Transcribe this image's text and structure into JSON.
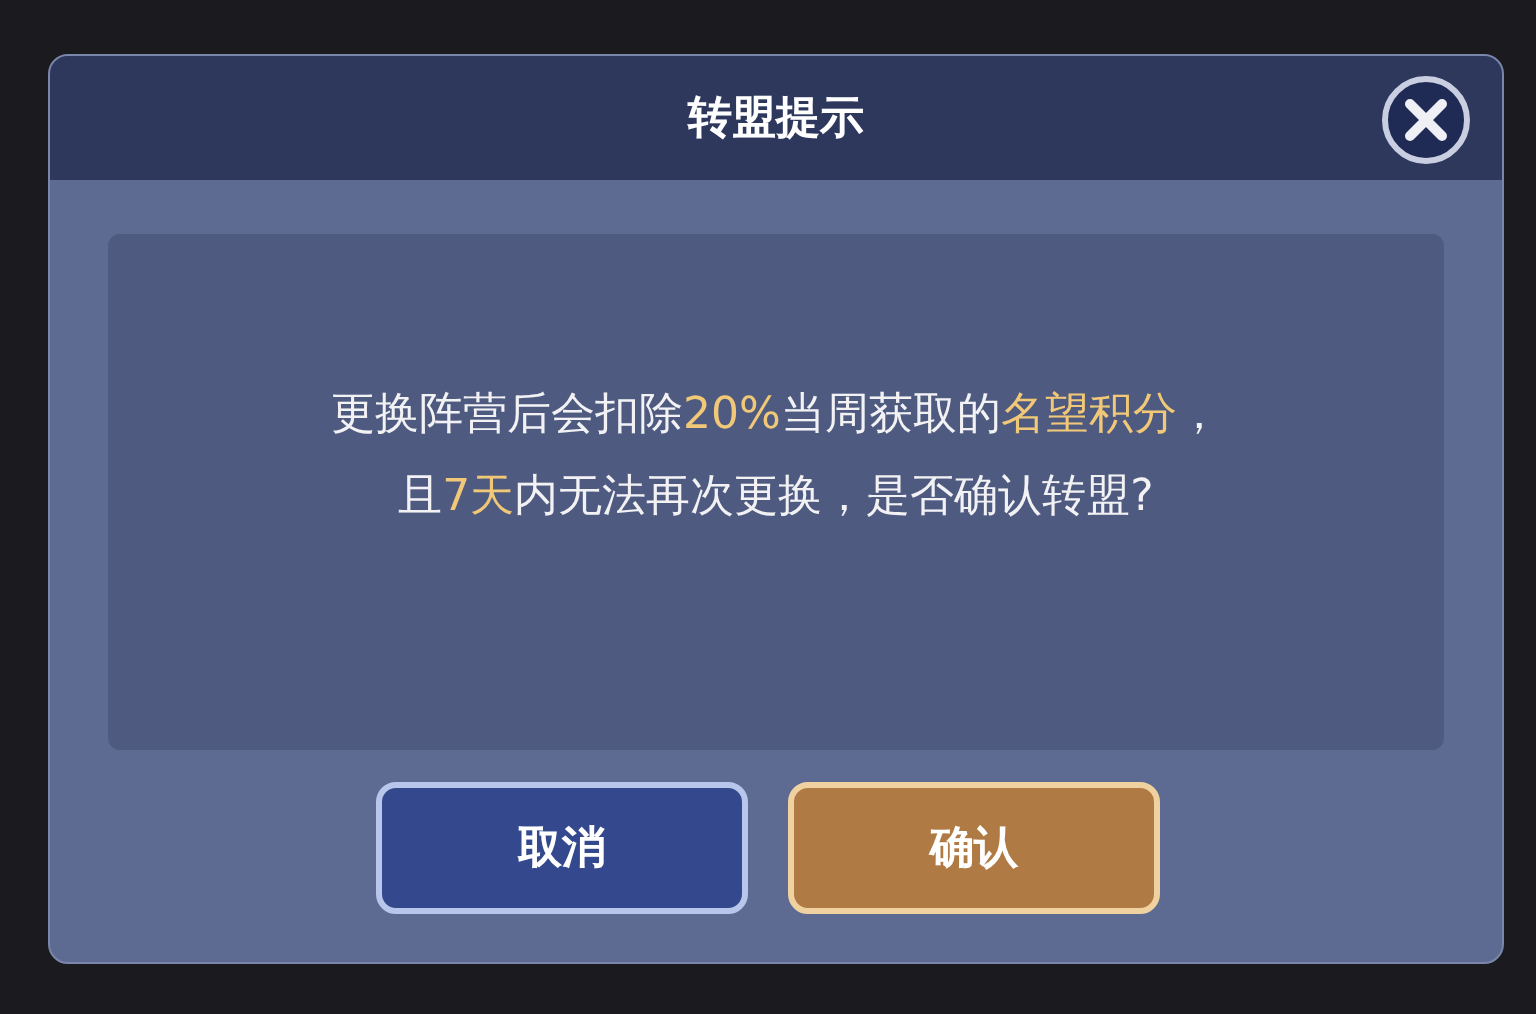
{
  "dialog": {
    "title": "转盟提示",
    "message_lines": [
      [
        {
          "text": "更换阵营后会扣除",
          "highlight": false
        },
        {
          "text": "20%",
          "highlight": true
        },
        {
          "text": "当周获取的",
          "highlight": false
        },
        {
          "text": "名望积分",
          "highlight": true
        },
        {
          "text": "，",
          "highlight": false
        }
      ],
      [
        {
          "text": "且",
          "highlight": false
        },
        {
          "text": "7天",
          "highlight": true
        },
        {
          "text": "内无法再次更换，是否确认转盟?",
          "highlight": false
        }
      ]
    ],
    "buttons": [
      {
        "label": "取消",
        "kind": "cancel"
      },
      {
        "label": "确认",
        "kind": "confirm"
      }
    ]
  }
}
